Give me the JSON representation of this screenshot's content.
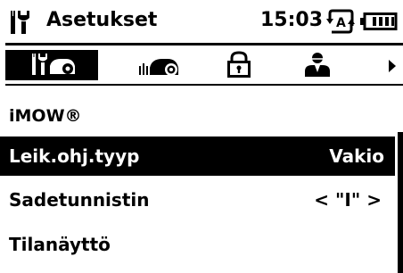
{
  "header": {
    "title": "Asetukset",
    "time": "15:03",
    "icons": [
      "settings-wrench-icon",
      "auto-mode-icon",
      "battery-icon"
    ]
  },
  "tabs": [
    {
      "icon": "mower-settings-icon",
      "active": true
    },
    {
      "icon": "mower-icon",
      "active": false
    },
    {
      "icon": "lock-icon",
      "active": false
    },
    {
      "icon": "user-icon",
      "active": false
    },
    {
      "icon": "arrow-right-icon",
      "active": false
    }
  ],
  "section": {
    "title": "iMOW®"
  },
  "menu": {
    "items": [
      {
        "label": "Leik.ohj.tyyp",
        "value": "Vakio",
        "selected": true
      },
      {
        "label": "Sadetunnistin",
        "value": "< \"I\" >",
        "selected": false
      },
      {
        "label": "Tilanäyttö",
        "value": "",
        "selected": false
      }
    ]
  },
  "colors": {
    "foreground": "#000000",
    "background": "#ffffff"
  }
}
